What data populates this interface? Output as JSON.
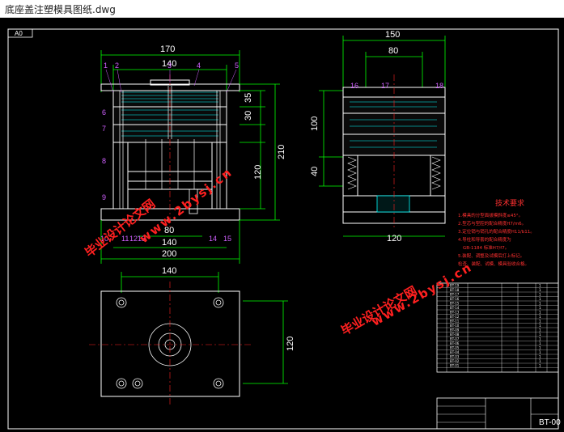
{
  "window": {
    "title": "底座盖注塑模具图纸.dwg"
  },
  "sheet": {
    "size_label": "A0"
  },
  "front_view": {
    "top_dims": [
      "170",
      "140"
    ],
    "bottom_dims": [
      "80",
      "140",
      "200"
    ],
    "right_dims": [
      "35",
      "30",
      "120",
      "210"
    ],
    "callouts_top": [
      "1",
      "2",
      "3",
      "4",
      "5"
    ],
    "callouts_left": [
      "6",
      "7",
      "8",
      "9"
    ],
    "callouts_bottom": [
      "10",
      "11",
      "12",
      "13",
      "14",
      "15"
    ]
  },
  "side_view": {
    "top_dims": [
      "150",
      "80"
    ],
    "left_dims": [
      "100",
      "40"
    ],
    "bottom_dims": [
      "120"
    ],
    "callouts": [
      "16",
      "17",
      "18"
    ]
  },
  "plan_view": {
    "top_dims": [
      "140"
    ],
    "right_dims": [
      "120"
    ]
  },
  "watermarks": [
    {
      "text": "毕业设计论文网"
    },
    {
      "text": "www.2bysj.cn"
    }
  ],
  "tech_requirements": {
    "title": "技术要求",
    "lines": [
      "1.模具的分型面拔模斜度≤45°。",
      "2.型芯与型腔的配合精度H7/m6。",
      "3.定位销与销孔的配合精度H11/b11。",
      "4.导柱和导套的配合精度为",
      "GB-1184 标准H7/f7。",
      "5.装配、调整及试模后打上标记。",
      "检查、装配、试模、模具验收合格。"
    ]
  },
  "title_block": {
    "drawing_no": "BT-00",
    "parts": [
      {
        "code": "BT-19",
        "qty": "1"
      },
      {
        "code": "BT-18",
        "qty": "1"
      },
      {
        "code": "BT-17",
        "qty": "1"
      },
      {
        "code": "BT-16",
        "qty": "1"
      },
      {
        "code": "BT-15",
        "qty": "1"
      },
      {
        "code": "BT-14",
        "qty": "1"
      },
      {
        "code": "BT-13",
        "qty": "1"
      },
      {
        "code": "BT-12",
        "qty": "1"
      },
      {
        "code": "BT-11",
        "qty": "1"
      },
      {
        "code": "BT-10",
        "qty": "1"
      },
      {
        "code": "BT-09",
        "qty": "1"
      },
      {
        "code": "BT-08",
        "qty": "1"
      },
      {
        "code": "BT-07",
        "qty": "1"
      },
      {
        "code": "BT-06",
        "qty": "1"
      },
      {
        "code": "BT-05",
        "qty": "1"
      },
      {
        "code": "BT-04",
        "qty": "1"
      },
      {
        "code": "BT-03",
        "qty": "1"
      },
      {
        "code": "BT-02",
        "qty": "1"
      },
      {
        "code": "BT-01",
        "qty": "1"
      }
    ]
  },
  "colors": {
    "background": "#000000",
    "outline": "#ffffff",
    "dimension": "#00ff00",
    "section": "#00ffff",
    "centerline": "#ff2020",
    "callout": "#d060ff",
    "watermark": "#ff2020"
  }
}
